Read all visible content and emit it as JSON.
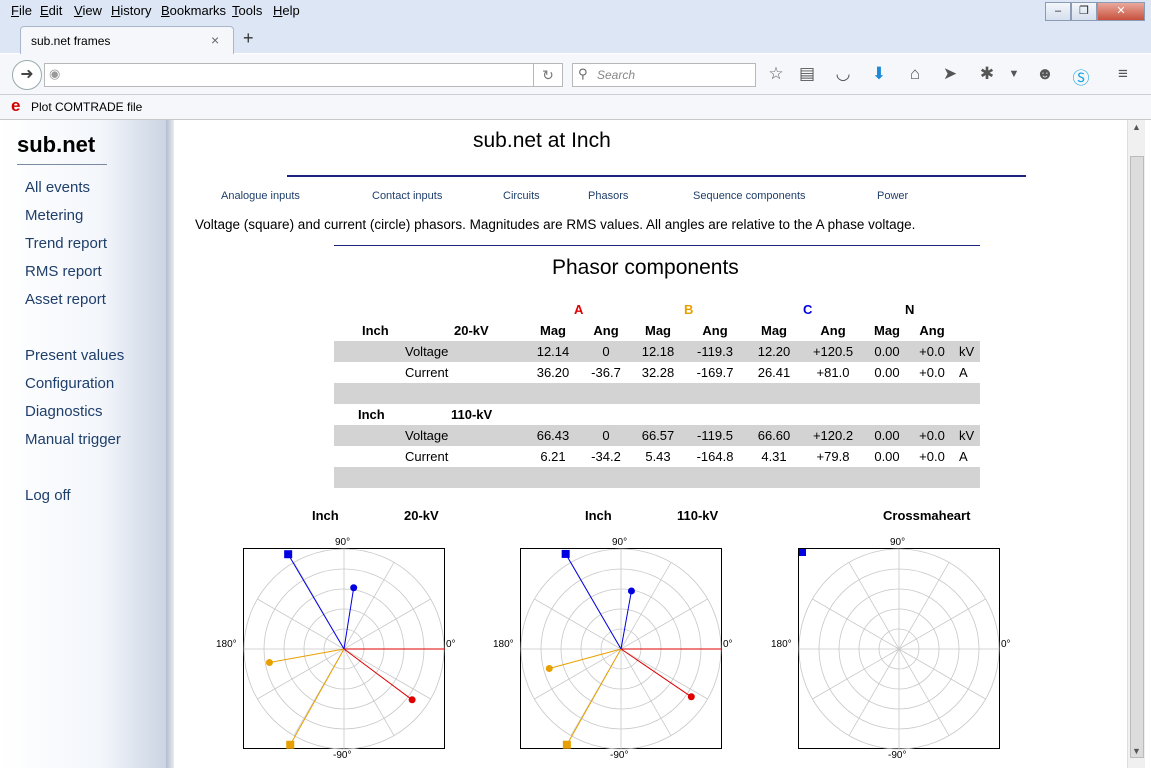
{
  "menu": [
    "File",
    "Edit",
    "View",
    "History",
    "Bookmarks",
    "Tools",
    "Help"
  ],
  "tab": {
    "title": "sub.net frames",
    "new_tab": "+",
    "close": "×"
  },
  "nav": {
    "search_placeholder": "Search"
  },
  "bookmark": {
    "icon": "e",
    "label": "Plot COMTRADE file"
  },
  "sidebar": {
    "brand": "sub.net",
    "group1": [
      "All events",
      "Metering",
      "Trend report",
      "RMS report",
      "Asset report"
    ],
    "group2": [
      "Present values",
      "Configuration",
      "Diagnostics",
      "Manual trigger"
    ],
    "logoff": "Log off"
  },
  "page": {
    "title": "sub.net at Inch",
    "subnav": [
      "Analogue inputs",
      "Contact inputs",
      "Circuits",
      "Phasors",
      "Sequence components",
      "Power"
    ],
    "description": "Voltage (square) and current (circle) phasors. Magnitudes are RMS values. All angles are relative to the A phase voltage.",
    "section_title": "Phasor components"
  },
  "phase_headers": {
    "A": "A",
    "B": "B",
    "C": "C",
    "N": "N"
  },
  "colors": {
    "A": "#e00000",
    "B": "#e8a000",
    "C": "#0000e0",
    "N": "#000000",
    "row_grey": "#d3d3d3",
    "link": "#1f3f6b"
  },
  "col_labels": [
    "Mag",
    "Ang",
    "Mag",
    "Ang",
    "Mag",
    "Ang",
    "Mag",
    "Ang"
  ],
  "groups": [
    {
      "site": "Inch",
      "voltage_level": "20-kV",
      "rows": [
        {
          "name": "Voltage",
          "values": [
            "12.14",
            "0",
            "12.18",
            "-119.3",
            "12.20",
            "+120.5",
            "0.00",
            "+0.0"
          ],
          "unit": "kV"
        },
        {
          "name": "Current",
          "values": [
            "36.20",
            "-36.7",
            "32.28",
            "-169.7",
            "26.41",
            "+81.0",
            "0.00",
            "+0.0"
          ],
          "unit": "A"
        }
      ]
    },
    {
      "site": "Inch",
      "voltage_level": "110-kV",
      "rows": [
        {
          "name": "Voltage",
          "values": [
            "66.43",
            "0",
            "66.57",
            "-119.5",
            "66.60",
            "+120.2",
            "0.00",
            "+0.0"
          ],
          "unit": "kV"
        },
        {
          "name": "Current",
          "values": [
            "6.21",
            "-34.2",
            "5.43",
            "-164.8",
            "4.31",
            "+79.8",
            "0.00",
            "+0.0"
          ],
          "unit": "A"
        }
      ]
    }
  ],
  "diagrams": [
    {
      "title_left": "Inch",
      "title_right": "20-kV"
    },
    {
      "title_left": "Inch",
      "title_right": "110-kV"
    },
    {
      "title_left": "",
      "title_right": "Crossmaheart"
    }
  ],
  "axis_labels": {
    "top": "90°",
    "bottom": "-90°",
    "left": "180°",
    "right": "0°"
  },
  "chart_data": [
    {
      "type": "scatter",
      "title": "Inch 20-kV",
      "subtype": "polar phasor",
      "series": [
        {
          "name": "A",
          "voltage": {
            "mag": 12.14,
            "ang": 0
          },
          "current": {
            "mag": 36.2,
            "ang": -36.7
          }
        },
        {
          "name": "B",
          "voltage": {
            "mag": 12.18,
            "ang": -119.3
          },
          "current": {
            "mag": 32.28,
            "ang": -169.7
          }
        },
        {
          "name": "C",
          "voltage": {
            "mag": 12.2,
            "ang": 120.5
          },
          "current": {
            "mag": 26.41,
            "ang": 81.0
          }
        }
      ]
    },
    {
      "type": "scatter",
      "title": "Inch 110-kV",
      "subtype": "polar phasor",
      "series": [
        {
          "name": "A",
          "voltage": {
            "mag": 66.43,
            "ang": 0
          },
          "current": {
            "mag": 6.21,
            "ang": -34.2
          }
        },
        {
          "name": "B",
          "voltage": {
            "mag": 66.57,
            "ang": -119.5
          },
          "current": {
            "mag": 5.43,
            "ang": -164.8
          }
        },
        {
          "name": "C",
          "voltage": {
            "mag": 66.6,
            "ang": 120.2
          },
          "current": {
            "mag": 4.31,
            "ang": 79.8
          }
        }
      ]
    },
    {
      "type": "scatter",
      "title": "Crossmaheart",
      "subtype": "polar phasor",
      "series": []
    }
  ]
}
